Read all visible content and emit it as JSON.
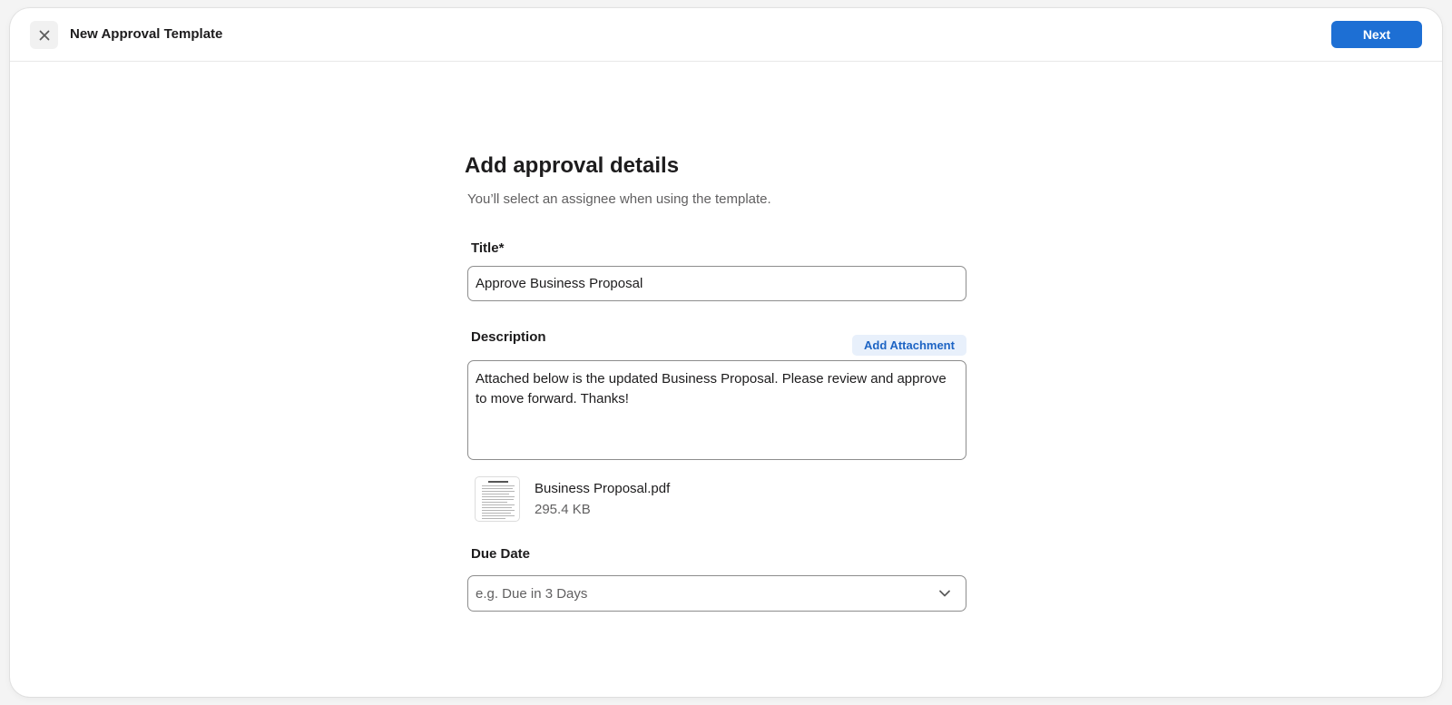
{
  "header": {
    "title": "New Approval Template",
    "close_icon": "close-icon",
    "next_label": "Next"
  },
  "form": {
    "heading": "Add approval details",
    "subheading": "You’ll select an assignee when using the template.",
    "title_label": "Title*",
    "title_value": "Approve Business Proposal",
    "description_label": "Description",
    "add_attachment_label": "Add Attachment",
    "description_value": "Attached below is the updated Business Proposal. Please review and approve to move forward. Thanks!",
    "attachment": {
      "name": "Business Proposal.pdf",
      "size": "295.4 KB",
      "thumbnail_icon": "pdf-document-thumbnail"
    },
    "due_date_label": "Due Date",
    "due_date_placeholder": "e.g. Due in 3 Days",
    "due_date_icon": "chevron-down-icon"
  },
  "colors": {
    "primary": "#1d6fd4",
    "attach_button_bg": "#e8f0fb",
    "attach_button_text": "#1d64c4",
    "border": "#8d8d8d",
    "muted_text": "#616061"
  }
}
